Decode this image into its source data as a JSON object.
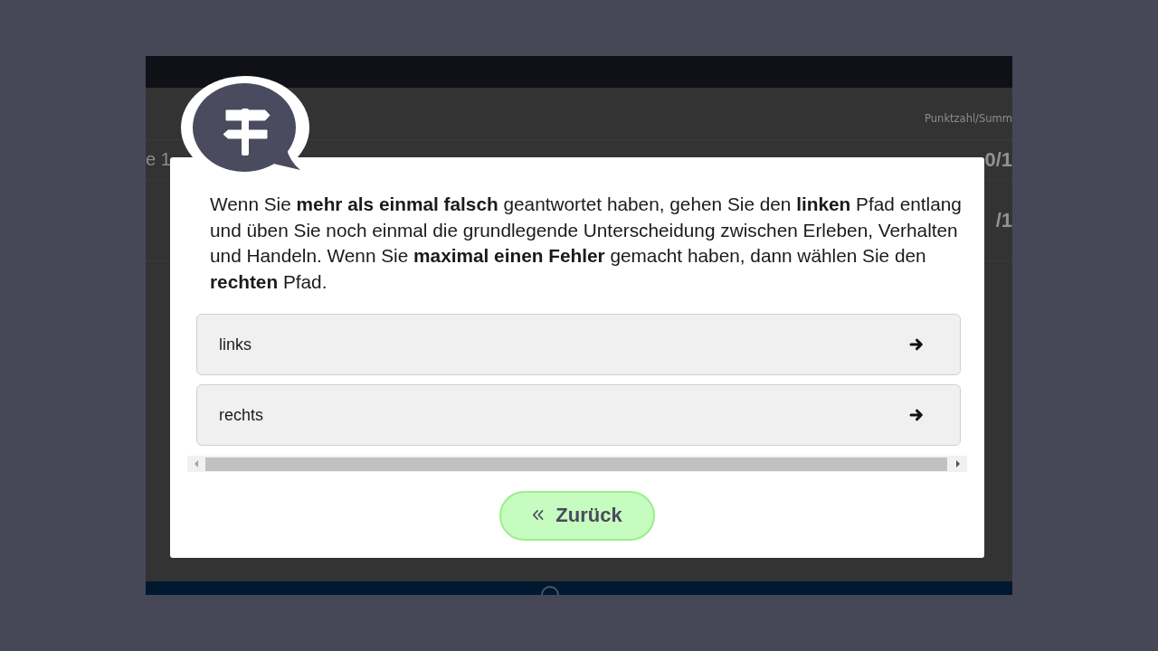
{
  "background_page": {
    "score_header": "Punktzahl/Summ",
    "rows": [
      {
        "label": "e 1",
        "score": "0/1"
      },
      {
        "score": "/1"
      }
    ]
  },
  "dialog": {
    "message": "Wenn Sie **mehr als einmal falsch** geantwortet haben, gehen Sie den **linken** Pfad entlang und üben Sie noch einmal die grundlegende Unterscheidung zwischen Erleben, Verhalten und Handeln. Wenn Sie **maximal einen Fehler** gemacht haben, dann wählen Sie den **rechten** Pfad.",
    "choices": [
      {
        "label": "links"
      },
      {
        "label": "rechts"
      }
    ],
    "back_button": {
      "label": "Zurück"
    }
  }
}
